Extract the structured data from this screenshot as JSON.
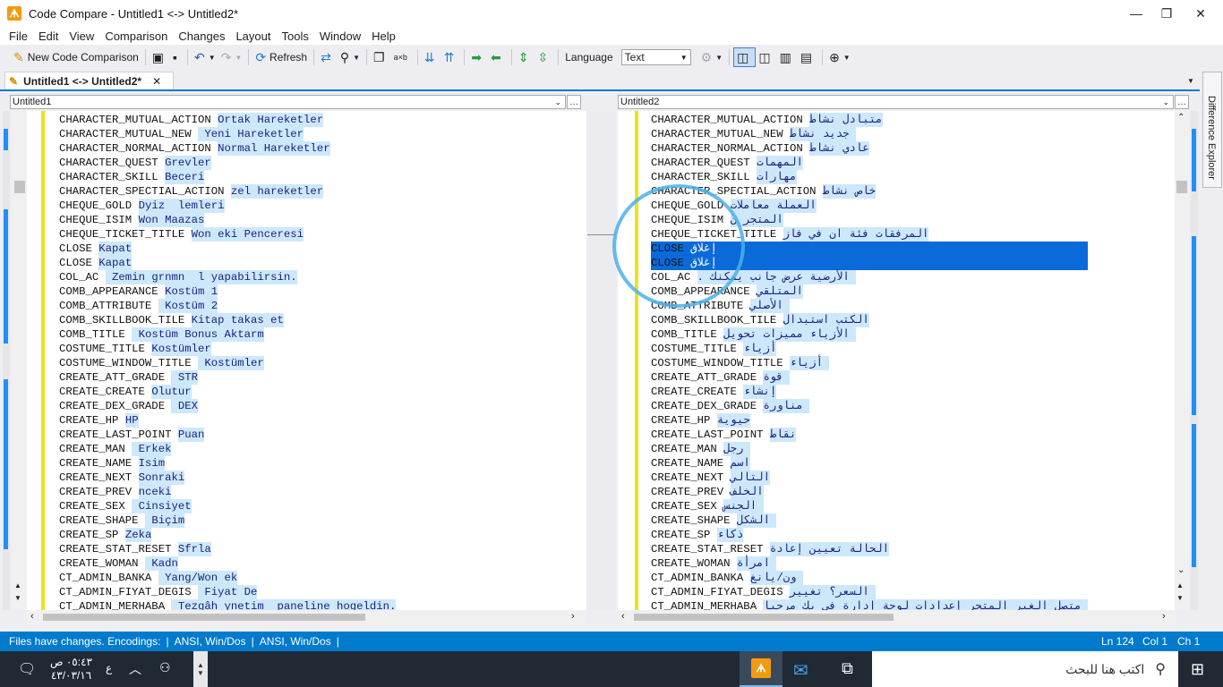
{
  "window": {
    "title": "Code Compare - Untitled1 <-> Untitled2*",
    "app_icon": "code-compare-icon",
    "controls": [
      "—",
      "❐",
      "✕"
    ]
  },
  "menu": [
    "File",
    "Edit",
    "View",
    "Comparison",
    "Changes",
    "Layout",
    "Tools",
    "Window",
    "Help"
  ],
  "toolbar": {
    "new_comparison": "New Code Comparison",
    "refresh": "Refresh",
    "language_label": "Language",
    "language_value": "Text"
  },
  "tab": {
    "label": "Untitled1 <-> Untitled2*",
    "close": "✕"
  },
  "side_panel": {
    "label": "Difference Explorer"
  },
  "left": {
    "path": "Untitled1",
    "lines": [
      [
        "CHARACTER_MUTUAL_ACTION",
        "Ortak Hareketler"
      ],
      [
        "CHARACTER_MUTUAL_NEW",
        " Yeni Hareketler"
      ],
      [
        "CHARACTER_NORMAL_ACTION",
        "Normal Hareketler"
      ],
      [
        "CHARACTER_QUEST",
        "Grevler"
      ],
      [
        "CHARACTER_SKILL",
        "Beceri"
      ],
      [
        "CHARACTER_SPECTIAL_ACTION",
        "zel hareketler"
      ],
      [
        "CHEQUE_GOLD",
        "Dyiz  lemleri"
      ],
      [
        "CHEQUE_ISIM",
        "Won Maazas"
      ],
      [
        "CHEQUE_TICKET_TITLE",
        "Won eki Penceresi"
      ],
      [
        "CLOSE",
        "Kapat"
      ],
      [
        "CLOSE",
        "Kapat"
      ],
      [
        "COL_AC",
        " Zemin grnmn  l yapabilirsin."
      ],
      [
        "COMB_APPEARANCE",
        "Kostüm 1"
      ],
      [
        "COMB_ATTRIBUTE",
        " Kostüm 2"
      ],
      [
        "COMB_SKILLBOOK_TILE",
        "Kitap takas et"
      ],
      [
        "COMB_TITLE",
        " Kostüm Bonus Aktarm"
      ],
      [
        "COSTUME_TITLE",
        "Kostümler"
      ],
      [
        "COSTUME_WINDOW_TITLE",
        " Kostümler"
      ],
      [
        "CREATE_ATT_GRADE",
        " STR"
      ],
      [
        "CREATE_CREATE",
        "Olutur"
      ],
      [
        "CREATE_DEX_GRADE",
        " DEX"
      ],
      [
        "CREATE_HP",
        "HP"
      ],
      [
        "CREATE_LAST_POINT",
        "Puan"
      ],
      [
        "CREATE_MAN",
        " Erkek"
      ],
      [
        "CREATE_NAME",
        "Isim"
      ],
      [
        "CREATE_NEXT",
        "Sonraki"
      ],
      [
        "CREATE_PREV",
        "nceki"
      ],
      [
        "CREATE_SEX",
        " Cinsiyet"
      ],
      [
        "CREATE_SHAPE",
        " Biçim"
      ],
      [
        "CREATE_SP",
        "Zeka"
      ],
      [
        "CREATE_STAT_RESET",
        "Sfrla"
      ],
      [
        "CREATE_WOMAN",
        " Kadn"
      ],
      [
        "CT_ADMIN_BANKA",
        " Yang/Won ek"
      ],
      [
        "CT_ADMIN_FIYAT_DEGIS",
        " Fiyat De"
      ],
      [
        "CT_ADMIN_MERHABA",
        " Tezgâh ynetim  paneline hogeldin."
      ]
    ]
  },
  "right": {
    "path": "Untitled2",
    "lines": [
      [
        "CHARACTER_MUTUAL_ACTION",
        "متبادل نشاط"
      ],
      [
        "CHARACTER_MUTUAL_NEW",
        " جديد نشاط"
      ],
      [
        "CHARACTER_NORMAL_ACTION",
        "عادي نشاط"
      ],
      [
        "CHARACTER_QUEST",
        "المهمات"
      ],
      [
        "CHARACTER_SKILL",
        "مهارات"
      ],
      [
        "CHARACTER_SPECTIAL_ACTION",
        "خاص نشاط"
      ],
      [
        "CHEQUE_GOLD",
        "العملة معاملات"
      ],
      [
        "CHEQUE_ISIM",
        "المتجر ن"
      ],
      [
        "CHEQUE_TICKET_TITLE",
        "المرفقات فئة ان في فاز"
      ],
      [
        "CLOSE",
        "إغلاق"
      ],
      [
        "CLOSE",
        "إغلاق"
      ],
      [
        "COL_AC",
        " الأرضية عرض جانب يمكنك ."
      ],
      [
        "COMB_APPEARANCE",
        "المتلقي"
      ],
      [
        "COMB_ATTRIBUTE",
        " الأصلي"
      ],
      [
        "COMB_SKILLBOOK_TILE",
        "الكتب استبدال"
      ],
      [
        "COMB_TITLE",
        " الأزياء مميزات تحويل"
      ],
      [
        "COSTUME_TITLE",
        "أزياء"
      ],
      [
        "COSTUME_WINDOW_TITLE",
        " أزياء"
      ],
      [
        "CREATE_ATT_GRADE",
        " قوة"
      ],
      [
        "CREATE_CREATE",
        "إنشاء"
      ],
      [
        "CREATE_DEX_GRADE",
        " مناورة"
      ],
      [
        "CREATE_HP",
        "حيوية"
      ],
      [
        "CREATE_LAST_POINT",
        "نقاط"
      ],
      [
        "CREATE_MAN",
        " رجل"
      ],
      [
        "CREATE_NAME",
        "اسم"
      ],
      [
        "CREATE_NEXT",
        "التالي"
      ],
      [
        "CREATE_PREV",
        "الخلف"
      ],
      [
        "CREATE_SEX",
        " الجنس"
      ],
      [
        "CREATE_SHAPE",
        " الشكل"
      ],
      [
        "CREATE_SP",
        "ذكاء"
      ],
      [
        "CREATE_STAT_RESET",
        "الحالة تعيين إعادة"
      ],
      [
        "CREATE_WOMAN",
        " امرأة"
      ],
      [
        "CT_ADMIN_BANKA",
        " ون/يانغ"
      ],
      [
        "CT_ADMIN_FIYAT_DEGIS",
        " السعر؟ تغيير"
      ],
      [
        "CT_ADMIN_MERHABA",
        " متصل الغير المتجر إعدادات لوحة إدارة في بك مرحبا"
      ]
    ],
    "selected_rows": [
      9,
      10
    ]
  },
  "status": {
    "message": "Files have changes. Encodings:",
    "enc1": "ANSI, Win/Dos",
    "enc2": "ANSI, Win/Dos",
    "ln": "Ln 124",
    "col": "Col 1",
    "ch": "Ch 1"
  },
  "taskbar": {
    "search": "اكتب هنا للبحث",
    "time": "٠٥:٤٣ ص",
    "date": "٤٣/٠٣/١٦",
    "lang": "ع"
  },
  "colors": {
    "accent": "#007acc",
    "added": "#cde8fb",
    "selection": "#0a6ad9",
    "change_bar": "#f1e11e"
  }
}
